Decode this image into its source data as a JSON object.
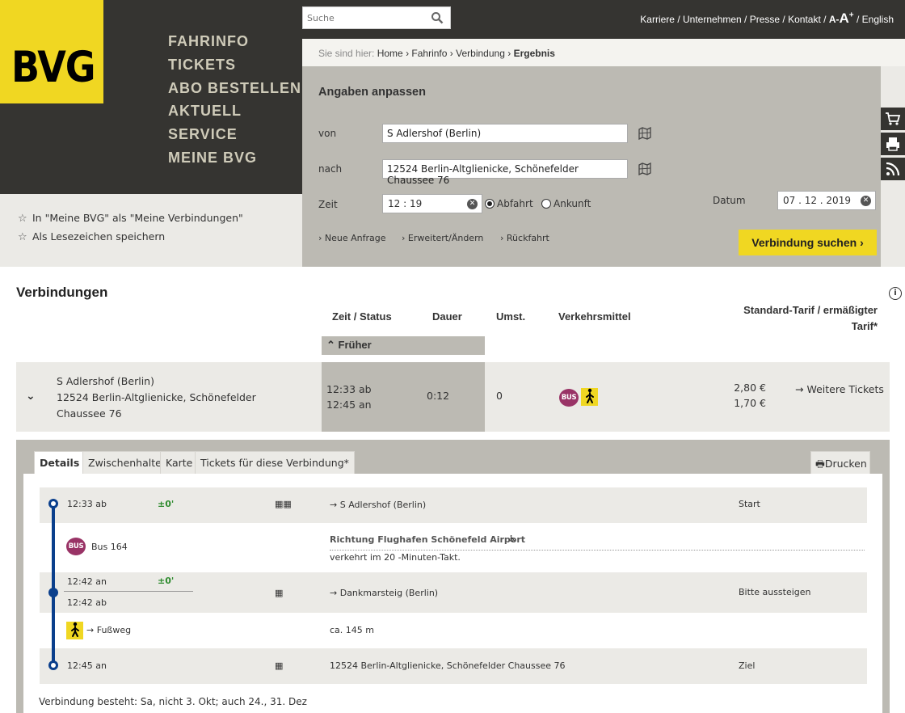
{
  "brand": {
    "logo_text": "BVG",
    "accent": "#f0d722",
    "dark": "#353431"
  },
  "nav": {
    "items": [
      "FAHRINFO",
      "TICKETS",
      "ABO BESTELLEN",
      "AKTUELL",
      "SERVICE",
      "MEINE BVG"
    ]
  },
  "search": {
    "placeholder": "Suche"
  },
  "top_links": {
    "karriere": "Karriere",
    "unternehmen": "Unternehmen",
    "presse": "Presse",
    "kontakt": "Kontakt",
    "font_small": "A-",
    "font_big": "A",
    "font_plus": "+",
    "english": "English",
    "sep": " / "
  },
  "favorites": {
    "meine_bvg": "In \"Meine BVG\" als \"Meine Verbindungen\"",
    "bookmark": "Als Lesezeichen speichern"
  },
  "breadcrumb": {
    "label": "Sie sind hier:",
    "items": [
      "Home",
      "Fahrinfo",
      "Verbindung"
    ],
    "current": "Ergebnis",
    "sep": "›"
  },
  "form": {
    "title": "Angaben anpassen",
    "von_label": "von",
    "von_value": "S Adlershof (Berlin)",
    "nach_label": "nach",
    "nach_value": "12524 Berlin-Altglienicke, Schönefelder Chaussee 76",
    "zeit_label": "Zeit",
    "zeit_value": "12 : 19",
    "abfahrt": "Abfahrt",
    "ankunft": "Ankunft",
    "datum_label": "Datum",
    "datum_value": "07 . 12 . 2019",
    "neue_anfrage": "Neue Anfrage",
    "erweitert": "Erweitert/Ändern",
    "rueckfahrt": "Rückfahrt",
    "search_button": "Verbindung suchen"
  },
  "results": {
    "title": "Verbindungen",
    "col_zeit": "Zeit / Status",
    "col_dauer": "Dauer",
    "col_umst": "Umst.",
    "col_verkehr": "Verkehrsmittel",
    "col_tarif": "Standard-Tarif / ermäßigter Tarif*",
    "earlier": "Früher",
    "connection": {
      "from": "S Adlershof (Berlin)",
      "to": "12524 Berlin-Altglienicke, Schönefelder Chaussee 76",
      "dep": "12:33 ab",
      "arr": "12:45 an",
      "duration": "0:12",
      "changes": "0",
      "bus_label": "BUS",
      "price_standard": "2,80 €",
      "price_reduced": "1,70 €",
      "more_tickets": "Weitere Tickets"
    }
  },
  "details": {
    "tabs": [
      "Details",
      "Zwischenhalte",
      "Karte",
      "Tickets für diese Verbindung*"
    ],
    "print": "Drucken",
    "rows": {
      "r1_time": "12:33 ab",
      "r1_delay": "±0'",
      "r1_stop": "S Adlershof (Berlin)",
      "r1_status": "Start",
      "bus_line": "Bus 164",
      "bus_direction": "Richtung Flughafen Schönefeld Airport",
      "bus_freq": "verkehrt im 20 -Minuten-Takt.",
      "r3_arr": "12:42 an",
      "r3_delay": "±0'",
      "r3_dep": "12:42 ab",
      "r3_stop": "Dankmarsteig (Berlin)",
      "r3_status": "Bitte aussteigen",
      "walk_label": "Fußweg",
      "walk_dist": "ca. 145 m",
      "r5_time": "12:45 an",
      "r5_stop": "12524 Berlin-Altglienicke, Schönefelder Chaussee 76",
      "r5_status": "Ziel"
    },
    "validity": "Verbindung besteht: Sa, nicht 3. Okt; auch 24., 31. Dez"
  }
}
